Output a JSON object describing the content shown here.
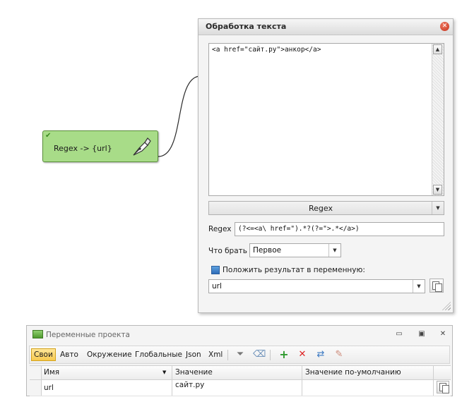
{
  "node": {
    "label": "Regex -> {url}",
    "check_icon": "check-icon",
    "icon": "pen-nib-icon"
  },
  "dialog": {
    "title": "Обработка текста",
    "close_icon": "close-icon",
    "text_value": "<a href=\"сайт.ру\">анкор</a>",
    "mode_dropdown": "Regex",
    "regex_label": "Regex",
    "regex_value": "(?<=<a\\ href=\").*?(?=\">.*</a>)",
    "take_label": "Что брать",
    "take_value": "Первое",
    "save_label": "Положить результат в переменную:",
    "save_var_value": "url"
  },
  "panel": {
    "title": "Переменные проекта",
    "tabs": [
      "Свои",
      "Авто",
      "Окружение",
      "Глобальные",
      "Json",
      "Xml"
    ],
    "active_tab": "Свои",
    "toolbar_icons": [
      "filter-icon",
      "eraser-icon",
      "add-icon",
      "delete-icon",
      "move-icon",
      "clear-icon"
    ],
    "columns": [
      "Имя",
      "Значение",
      "Значение по-умолчанию"
    ],
    "rows": [
      {
        "name": "url",
        "value": "сайт.ру",
        "default": ""
      }
    ]
  },
  "colors": {
    "node_fill": "#a8dc88",
    "node_border": "#5b8f3b",
    "active_tab": "#f7c94f",
    "close": "#c4301a"
  }
}
